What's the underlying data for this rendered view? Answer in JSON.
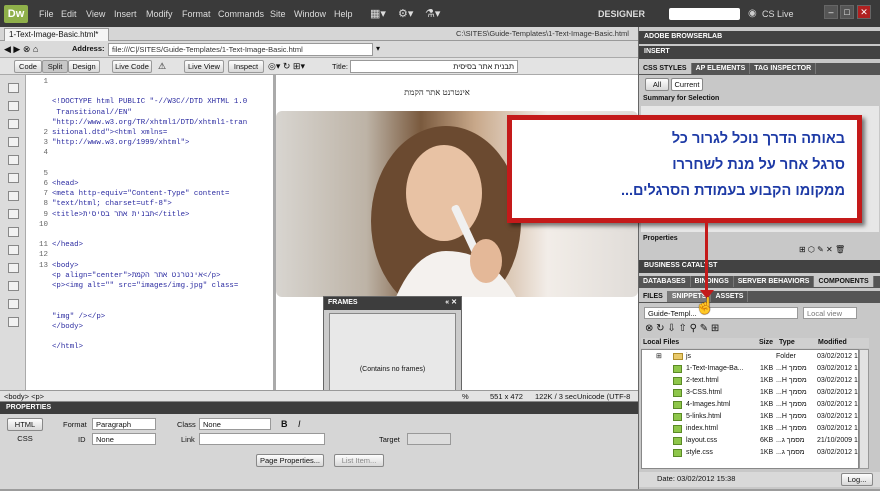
{
  "app": {
    "logo": "Dw",
    "workspace": "DESIGNER",
    "cs_live": "CS Live"
  },
  "menu": [
    "File",
    "Edit",
    "View",
    "Insert",
    "Modify",
    "Format",
    "Commands",
    "Site",
    "Window",
    "Help"
  ],
  "document": {
    "tab": "1-Text-Image-Basic.html*",
    "path": "C:\\SITES\\Guide-Templates\\1-Text-Image-Basic.html",
    "address_label": "Address:",
    "address": "file:///C|/SITES/Guide-Templates/1-Text-Image-Basic.html"
  },
  "view_toolbar": {
    "code": "Code",
    "split": "Split",
    "design": "Design",
    "live_code": "Live Code",
    "live_view": "Live View",
    "inspect": "Inspect",
    "title_label": "Title:",
    "title_value": "תבנית אתר בסיסית"
  },
  "code_lines": [
    {
      "n": "1",
      "t": "<!DOCTYPE html PUBLIC \"-//W3C//DTD XHTML 1.0"
    },
    {
      "n": "",
      "t": " Transitional//EN\""
    },
    {
      "n": "",
      "t": "\"http://www.w3.org/TR/xhtml1/DTD/xhtml1-tran"
    },
    {
      "n": "",
      "t": "sitional.dtd\"><html xmlns="
    },
    {
      "n": "",
      "t": "\"http://www.w3.org/1999/xhtml\">"
    },
    {
      "n": "2",
      "t": ""
    },
    {
      "n": "3",
      "t": "<head>"
    },
    {
      "n": "4",
      "t": "<meta http-equiv=\"Content-Type\" content="
    },
    {
      "n": "",
      "t": "\"text/html; charset=utf-8\">"
    },
    {
      "n": "5",
      "t": "<title>תבנית אתר בסיסית</title>"
    },
    {
      "n": "6",
      "t": "</head>"
    },
    {
      "n": "7",
      "t": ""
    },
    {
      "n": "8",
      "t": "<body>"
    },
    {
      "n": "9",
      "t": "<p align=\"center\">אינטרנט אתר הקמת</p>"
    },
    {
      "n": "10",
      "t": "<p><img alt=\"\" src=\"images/img.jpg\" class="
    },
    {
      "n": "",
      "t": "\"img\" /></p>"
    },
    {
      "n": "11",
      "t": "</body>"
    },
    {
      "n": "12",
      "t": ""
    },
    {
      "n": "13",
      "t": "</html>"
    }
  ],
  "design_view": {
    "heading": "אינטרנט אתר הקמת"
  },
  "callout": {
    "line1": "באותה הדרך נוכל לגרור כל",
    "line2": "סרגל אחר על מנת לשחררו",
    "line3": "ממקומו הקבוע בעמודת הסרגלים..."
  },
  "frames_panel": {
    "title": "FRAMES",
    "empty": "(Contains no frames)"
  },
  "status_bar": {
    "tags": "<body> <p>",
    "zoom": "%",
    "size": "551 x 472",
    "weight": "122K / 3 sec",
    "encoding": "Unicode (UTF-8"
  },
  "properties": {
    "title": "PROPERTIES",
    "html_btn": "HTML",
    "css_btn": "CSS",
    "format_label": "Format",
    "format_value": "Paragraph",
    "id_label": "ID",
    "id_value": "None",
    "class_label": "Class",
    "class_value": "None",
    "link_label": "Link",
    "target_label": "Target",
    "bold": "B",
    "italic": "I",
    "page_props": "Page Properties...",
    "list_item": "List Item..."
  },
  "right_panel": {
    "browserlab": "ADOBE BROWSERLAB",
    "insert": "INSERT",
    "css_tabs": [
      "CSS STYLES",
      "AP ELEMENTS",
      "TAG INSPECTOR"
    ],
    "all": "All",
    "current": "Current",
    "summary": "Summary for Selection",
    "properties": "Properties",
    "business": "BUSINESS CATALYST",
    "db_tabs": [
      "DATABASES",
      "BINDINGS",
      "SERVER BEHAVIORS",
      "COMPONENTS"
    ],
    "file_tabs": [
      "FILES",
      "SNIPPETS",
      "ASSETS"
    ],
    "site_select": "Guide-Templ...",
    "view_select": "Local view",
    "cols": {
      "name": "Local Files",
      "size": "Size",
      "type": "Type",
      "modified": "Modified"
    },
    "files": [
      {
        "name": "js",
        "size": "",
        "type": "Folder",
        "mod": "03/02/2012 1",
        "folder": true
      },
      {
        "name": "1-Text-Image-Ba...",
        "size": "1KB",
        "type": "מסמך H...",
        "mod": "03/02/2012 1",
        "folder": false
      },
      {
        "name": "2-text.html",
        "size": "1KB",
        "type": "מסמך H...",
        "mod": "03/02/2012 1",
        "folder": false
      },
      {
        "name": "3-CSS.html",
        "size": "1KB",
        "type": "מסמך H...",
        "mod": "03/02/2012 1",
        "folder": false
      },
      {
        "name": "4-Images.html",
        "size": "1KB",
        "type": "מסמך H...",
        "mod": "03/02/2012 1",
        "folder": false
      },
      {
        "name": "5-links.html",
        "size": "1KB",
        "type": "מסמך H...",
        "mod": "03/02/2012 1",
        "folder": false
      },
      {
        "name": "index.html",
        "size": "1KB",
        "type": "מסמך H...",
        "mod": "03/02/2012 1",
        "folder": false
      },
      {
        "name": "layout.css",
        "size": "6KB",
        "type": "מסמך ג...",
        "mod": "21/10/2009 1",
        "folder": false
      },
      {
        "name": "style.css",
        "size": "1KB",
        "type": "מסמך ג...",
        "mod": "03/02/2012 1",
        "folder": false
      }
    ],
    "file_status": "Date: 03/02/2012 15:38",
    "log": "Log..."
  },
  "colors": {
    "accent": "#c41a1a",
    "callout_text": "#1d3aa6",
    "chrome_dark": "#3a3a3a"
  }
}
